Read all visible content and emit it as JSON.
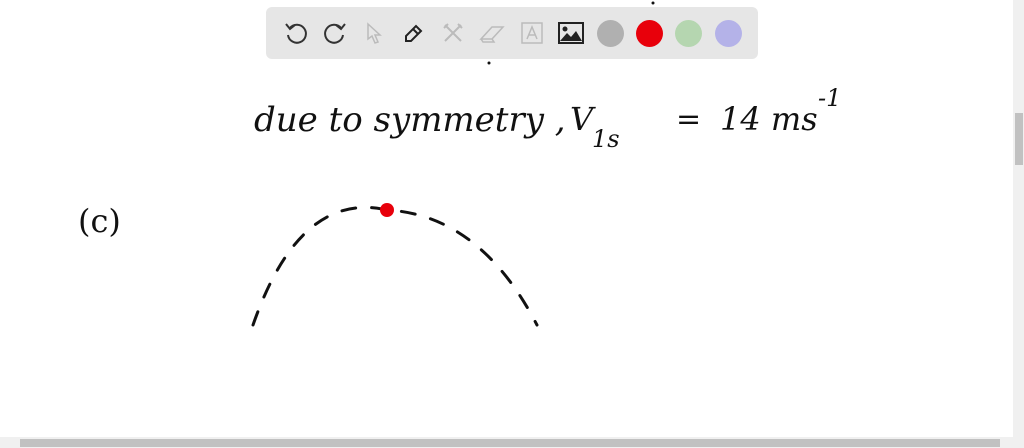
{
  "toolbar": {
    "tools": [
      "undo-icon",
      "redo-icon",
      "select-icon",
      "pen-icon",
      "tools-icon",
      "eraser-icon",
      "text-icon",
      "image-icon"
    ],
    "colors": [
      "#b0b0b0",
      "#e8000b",
      "#b5d6b0",
      "#b4b2e8"
    ],
    "selected_color": "#e8000b"
  },
  "board": {
    "line1": "due to symmetry ,",
    "velocity_symbol": "V",
    "velocity_subscript": "1s",
    "equals": "=",
    "value": "14 ms",
    "exponent": "-1",
    "part_label": "(c)"
  }
}
